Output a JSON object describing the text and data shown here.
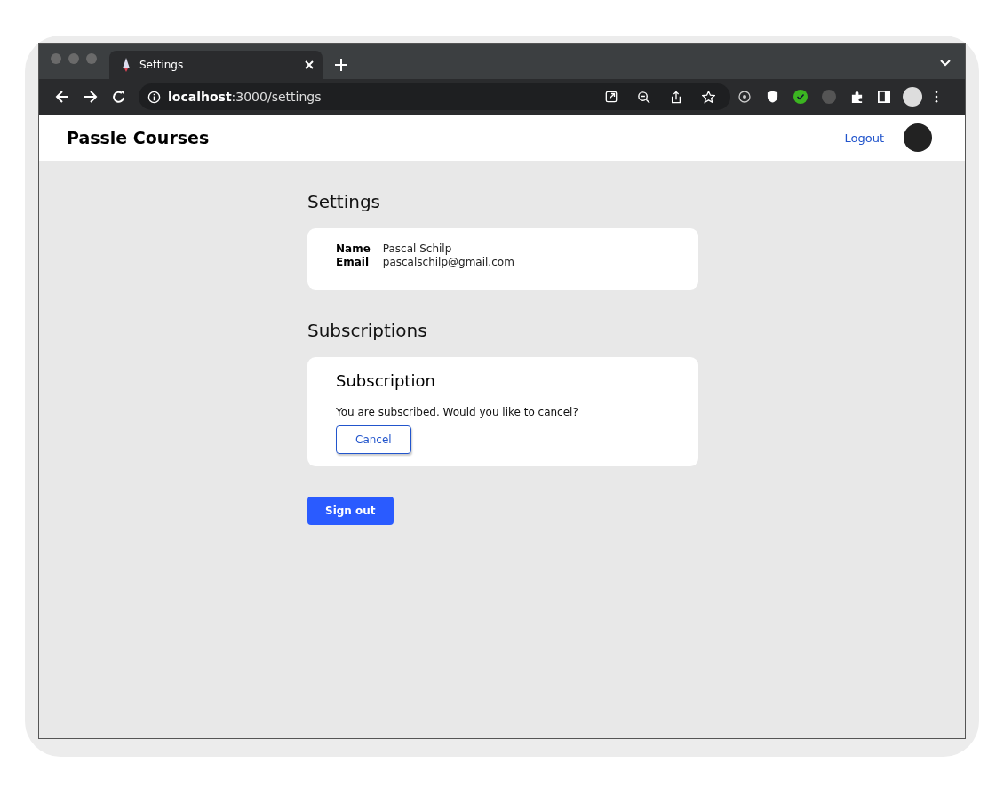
{
  "browser": {
    "tab": {
      "title": "Settings",
      "selected": true
    },
    "url": "**localhost**:3000/settings"
  },
  "header": {
    "brand": "Passle Courses",
    "logout": "Logout"
  },
  "settings": {
    "title": "Settings",
    "fields": [
      {
        "label": "Name",
        "value": "Pascal Schilp"
      },
      {
        "label": "Email",
        "value": "pascalschilp@gmail.com"
      }
    ]
  },
  "subscriptions": {
    "title": "Subscriptions",
    "card": {
      "title": "Subscription",
      "text": "You are subscribed. Would you like to cancel?",
      "button": "Cancel"
    }
  },
  "sign_out": "Sign out"
}
